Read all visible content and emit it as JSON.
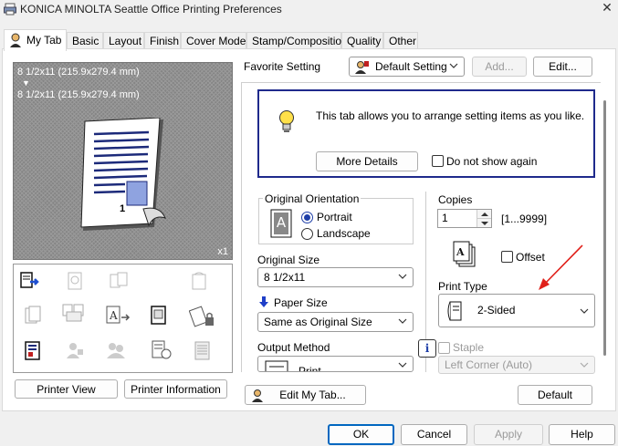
{
  "window": {
    "title": "KONICA MINOLTA Seattle Office Printing Preferences",
    "close_glyph": "✕"
  },
  "tabs": [
    {
      "label": "My Tab",
      "active": true
    },
    {
      "label": "Basic"
    },
    {
      "label": "Layout"
    },
    {
      "label": "Finish"
    },
    {
      "label": "Cover Mode"
    },
    {
      "label": "Stamp/Composition"
    },
    {
      "label": "Quality"
    },
    {
      "label": "Other"
    }
  ],
  "preview": {
    "paper_line1": "8 1/2x11 (215.9x279.4 mm)",
    "arrow": "▼",
    "paper_line2": "8 1/2x11 (215.9x279.4 mm)",
    "page_number": "1",
    "copies_marker": "x1"
  },
  "left_buttons": {
    "printer_view": "Printer View",
    "printer_information": "Printer Information"
  },
  "favorite": {
    "label": "Favorite Setting",
    "selected": "Default Setting",
    "add": "Add...",
    "edit": "Edit..."
  },
  "info": {
    "message": "This tab allows you to arrange setting items as you like.",
    "more_details": "More Details",
    "do_not_show": "Do not show again"
  },
  "orientation": {
    "title": "Original Orientation",
    "portrait": "Portrait",
    "landscape": "Landscape",
    "selected": "Portrait",
    "icon_letter": "A"
  },
  "original_size": {
    "label": "Original Size",
    "value": "8 1/2x11"
  },
  "paper_size": {
    "label": "Paper Size",
    "value": "Same as Original Size"
  },
  "output_method": {
    "label": "Output Method",
    "value": "Print"
  },
  "copies": {
    "label": "Copies",
    "value": "1",
    "range": "[1...9999]"
  },
  "offset": {
    "label": "Offset"
  },
  "print_type": {
    "label": "Print Type",
    "value": "2-Sided"
  },
  "staple": {
    "info_glyph": "i",
    "label": "Staple",
    "value": "Left Corner (Auto)"
  },
  "edit_my_tab": "Edit My Tab...",
  "default_button": "Default",
  "dialog": {
    "ok": "OK",
    "cancel": "Cancel",
    "apply": "Apply",
    "help": "Help"
  },
  "colors": {
    "info_border": "#1f2a8c",
    "radio_fill": "#1f3fa8",
    "annotation_arrow": "#e0201a"
  }
}
